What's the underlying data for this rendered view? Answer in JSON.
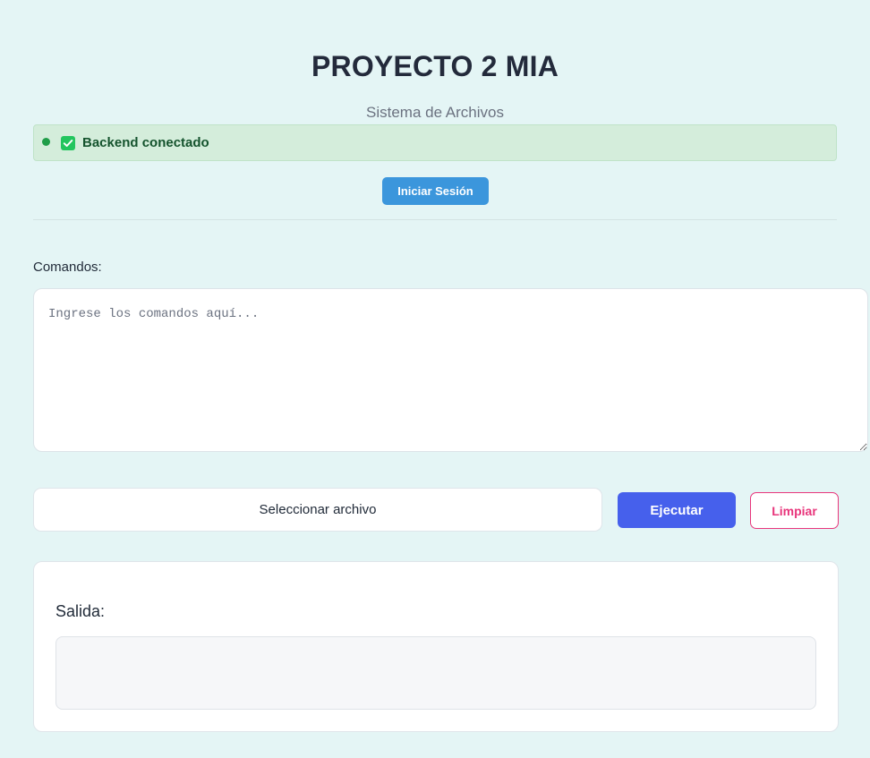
{
  "header": {
    "title": "PROYECTO 2 MIA",
    "subtitle": "Sistema de Archivos"
  },
  "status": {
    "text": "Backend conectado",
    "dot_color": "#1f9d48",
    "icon": "check-box-icon"
  },
  "auth": {
    "login_label": "Iniciar Sesión"
  },
  "commands": {
    "label": "Comandos:",
    "placeholder": "Ingrese los comandos aquí...",
    "value": ""
  },
  "actions": {
    "file_select_label": "Seleccionar archivo",
    "execute_label": "Ejecutar",
    "clear_label": "Limpiar"
  },
  "output": {
    "label": "Salida:",
    "value": ""
  },
  "colors": {
    "background": "#e4f5f5",
    "status_bg": "#d4eddb",
    "login_button": "#3b96dc",
    "execute_button": "#4660ec",
    "clear_button": "#e8357b",
    "check_icon": "#22c55e"
  }
}
